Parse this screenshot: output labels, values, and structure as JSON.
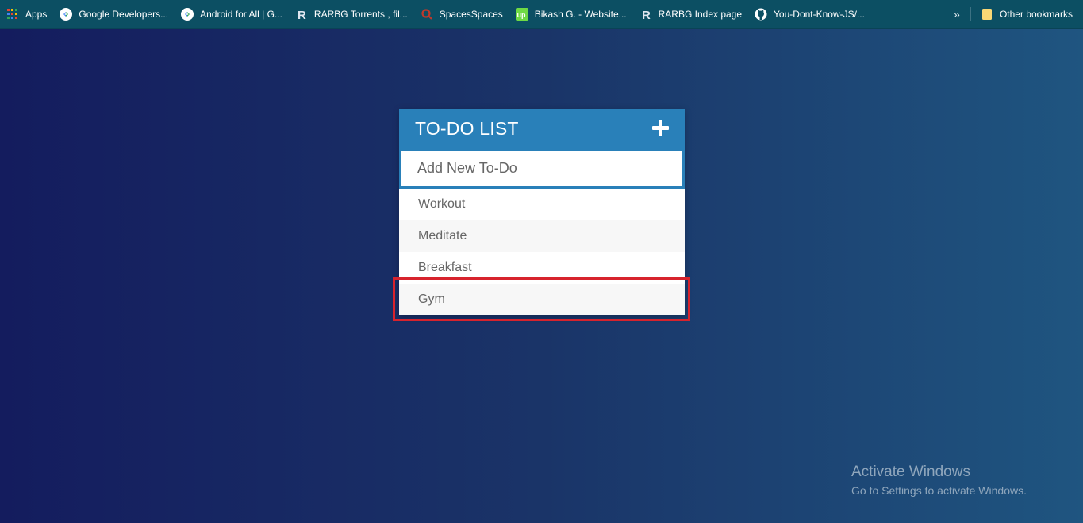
{
  "bookmarks": [
    {
      "icon": "apps-grid-icon",
      "label": "Apps"
    },
    {
      "icon": "google-developers-icon",
      "label": "Google Developers..."
    },
    {
      "icon": "android-for-all-icon",
      "label": "Android for All  |  G..."
    },
    {
      "icon": "rarbg-icon",
      "label": "RARBG Torrents , fil..."
    },
    {
      "icon": "spaces-icon",
      "label": "SpacesSpaces"
    },
    {
      "icon": "upwork-icon",
      "label": "Bikash G. - Website..."
    },
    {
      "icon": "rarbg-icon",
      "label": "RARBG Index page"
    },
    {
      "icon": "github-icon",
      "label": "You-Dont-Know-JS/..."
    }
  ],
  "bookmarks_more": "»",
  "other_bookmarks": {
    "icon": "folder-icon",
    "label": "Other bookmarks"
  },
  "todo": {
    "title": "TO-DO LIST",
    "input_placeholder": "Add New To-Do",
    "items": [
      "Workout",
      "Meditate",
      "Breakfast",
      "Gym"
    ]
  },
  "watermark": {
    "title": "Activate Windows",
    "subtitle": "Go to Settings to activate Windows."
  },
  "colors": {
    "accent": "#2980b9",
    "highlight": "#d7232d"
  }
}
